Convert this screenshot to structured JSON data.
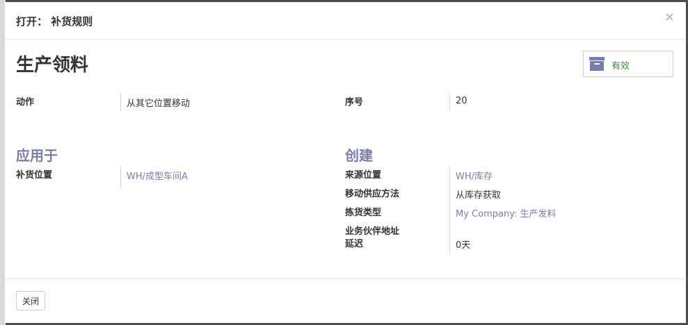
{
  "dialog": {
    "title": "打开： 补货规则",
    "close_symbol": "×"
  },
  "record": {
    "name": "生产领料",
    "active_toggle": {
      "label": "有效",
      "icon": "archive-box-icon",
      "label_color": "#3c8c3c"
    }
  },
  "fields_top": {
    "action": {
      "label": "动作",
      "value": "从其它位置移动"
    },
    "sequence": {
      "label": "序号",
      "value": "20"
    }
  },
  "section_applies": {
    "title": "应用于",
    "replenish_location": {
      "label": "补货位置",
      "value": "WH/成型车间A"
    }
  },
  "section_create": {
    "title": "创建",
    "source_location": {
      "label": "来源位置",
      "value": "WH/库存"
    },
    "procure_method": {
      "label": "移动供应方法",
      "value": "从库存获取"
    },
    "picking_type": {
      "label": "拣货类型",
      "value": "My Company: 生产发料"
    },
    "partner_address": {
      "label": "业务伙伴地址",
      "value": ""
    },
    "delay": {
      "label": "延迟",
      "value": "0天"
    }
  },
  "footer": {
    "close_button": "关闭"
  },
  "colors": {
    "link": "#7c7bad",
    "section": "#7c7bad",
    "text": "#333333"
  }
}
